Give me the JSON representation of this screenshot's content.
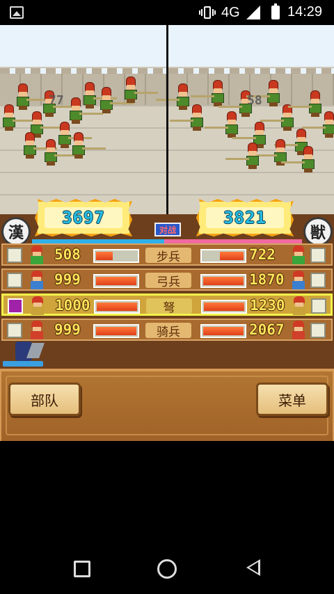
{
  "status_bar": {
    "network": "4G",
    "time": "14:29"
  },
  "battle": {
    "left_hit": "77",
    "right_hit": "58"
  },
  "scores": {
    "left": "3697",
    "right": "3821"
  },
  "factions": {
    "left": "漢",
    "right": "獣"
  },
  "vs_label": "对战",
  "balance_left_ratio": 0.49,
  "rows": [
    {
      "label": "步兵",
      "left_value": "508",
      "right_value": "722",
      "left_fill": 0.42,
      "right_fill": 0.58,
      "left_color": "#3aa53a",
      "right_color": "#3aa53a",
      "selected": false
    },
    {
      "label": "弓兵",
      "left_value": "999",
      "right_value": "1870",
      "left_fill": 1.0,
      "right_fill": 1.0,
      "left_color": "#3a7fd0",
      "right_color": "#3a7fd0",
      "selected": false
    },
    {
      "label": "弩",
      "left_value": "1000",
      "right_value": "1230",
      "left_fill": 1.0,
      "right_fill": 1.0,
      "left_color": "#c9a23a",
      "right_color": "#c9a23a",
      "selected": true
    },
    {
      "label": "骑兵",
      "left_value": "999",
      "right_value": "2067",
      "left_fill": 1.0,
      "right_fill": 1.0,
      "left_color": "#d0402a",
      "right_color": "#d0402a",
      "selected": false
    }
  ],
  "buttons": {
    "troops": "部队",
    "menu": "菜单"
  }
}
